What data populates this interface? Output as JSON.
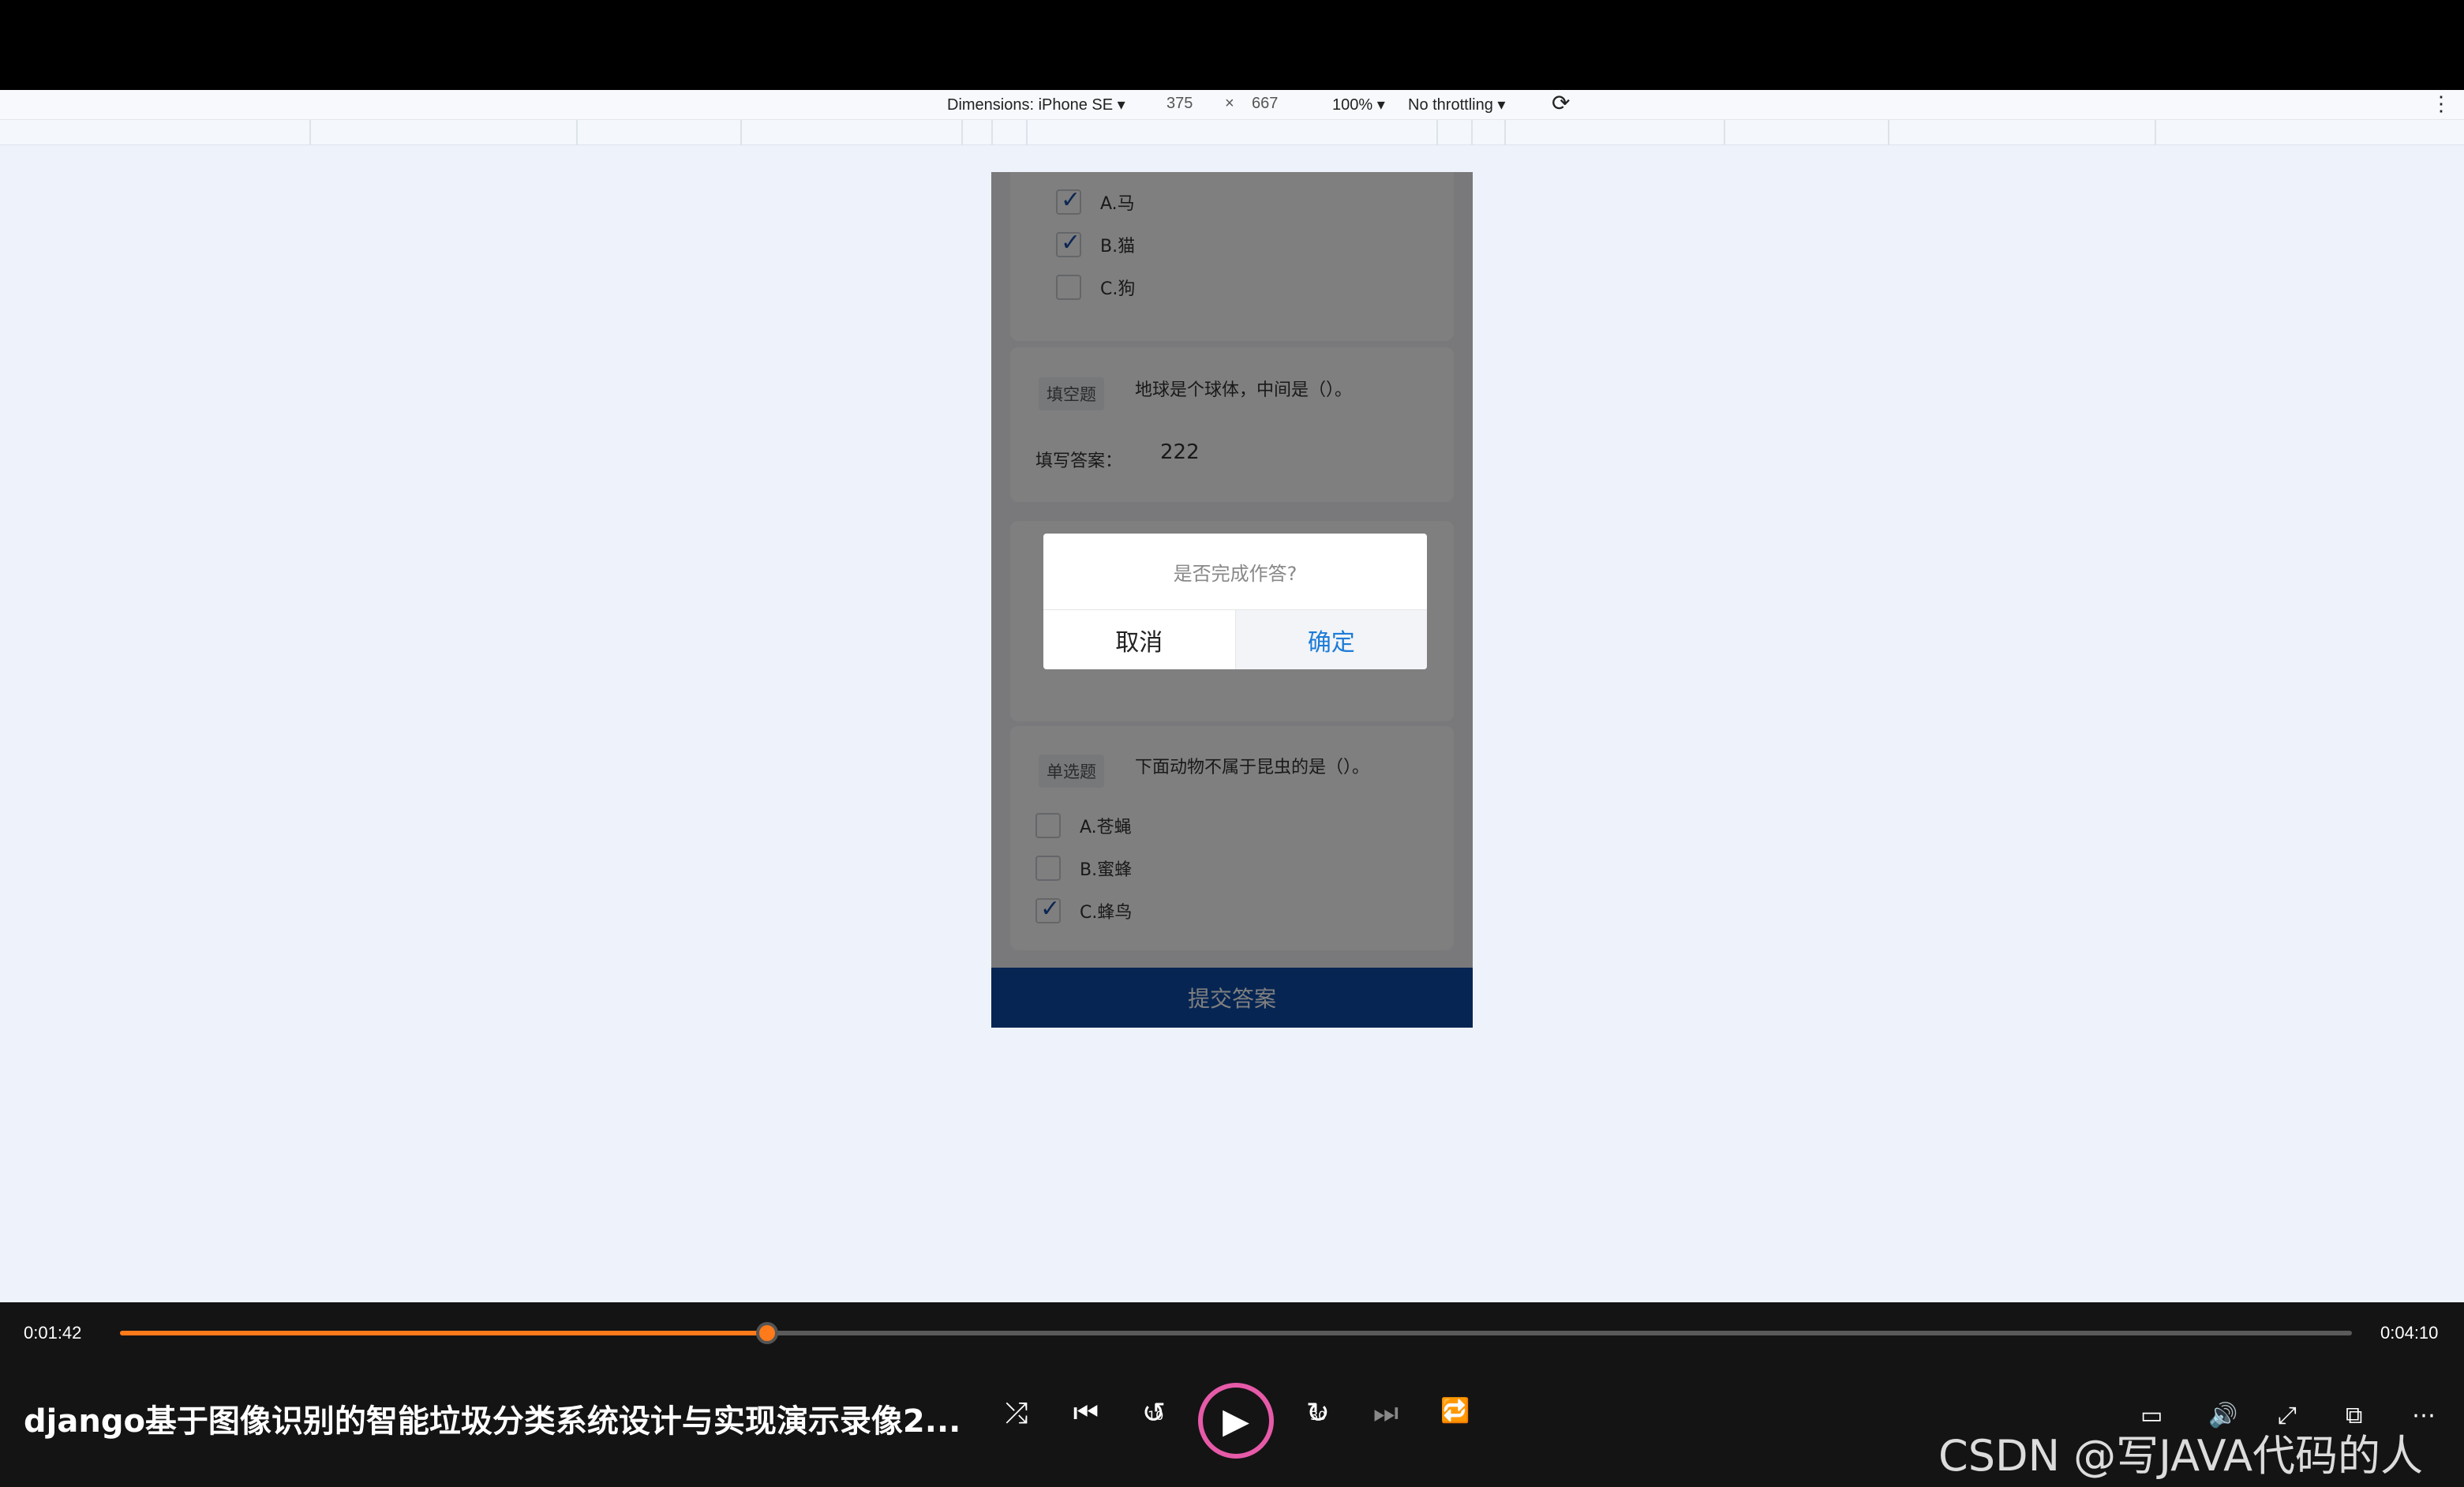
{
  "devtools": {
    "dimensions_label": "Dimensions: iPhone SE ▾",
    "width": "375",
    "times": "×",
    "height": "667",
    "zoom": "100% ▾",
    "throttling": "No throttling ▾",
    "rotate_icon": "⟳",
    "menu_icon": "⋮"
  },
  "quiz": {
    "q1_options": [
      {
        "label": "A.马",
        "checked": true
      },
      {
        "label": "B.猫",
        "checked": true
      },
      {
        "label": "C.狗",
        "checked": false
      }
    ],
    "q2": {
      "tag": "填空题",
      "text": "地球是个球体，中间是（）。",
      "answer_label": "填写答案：",
      "answer_value": "222"
    },
    "q4": {
      "tag": "单选题",
      "text": "下面动物不属于昆虫的是（）。",
      "options": [
        {
          "label": "A.苍蝇",
          "checked": false
        },
        {
          "label": "B.蜜蜂",
          "checked": false
        },
        {
          "label": "C.蜂鸟",
          "checked": true
        }
      ]
    },
    "submit_label": "提交答案"
  },
  "dialog": {
    "message": "是否完成作答?",
    "cancel_label": "取消",
    "confirm_label": "确定"
  },
  "player": {
    "current_time": "0:01:42",
    "duration": "0:04:10",
    "progress": 0.29,
    "title": "django基于图像识别的智能垃圾分类系统设计与实现演示录像2...",
    "icons": {
      "shuffle": "⤮",
      "prev": "⏮",
      "rewind": "↺",
      "play": "▶",
      "forward": "↻",
      "next": "⏭",
      "repeat": "🔁",
      "subtitle": "▭",
      "volume": "🔊",
      "fullscreen": "⤢",
      "pip": "⧉",
      "more": "⋯"
    },
    "rewind_seconds": "10",
    "forward_seconds": "30",
    "watermark": "CSDN @写JAVA代码的人"
  },
  "colors": {
    "accent": "#ff7a1a",
    "submit": "#0c4aa6",
    "confirm": "#1c7bd8"
  }
}
